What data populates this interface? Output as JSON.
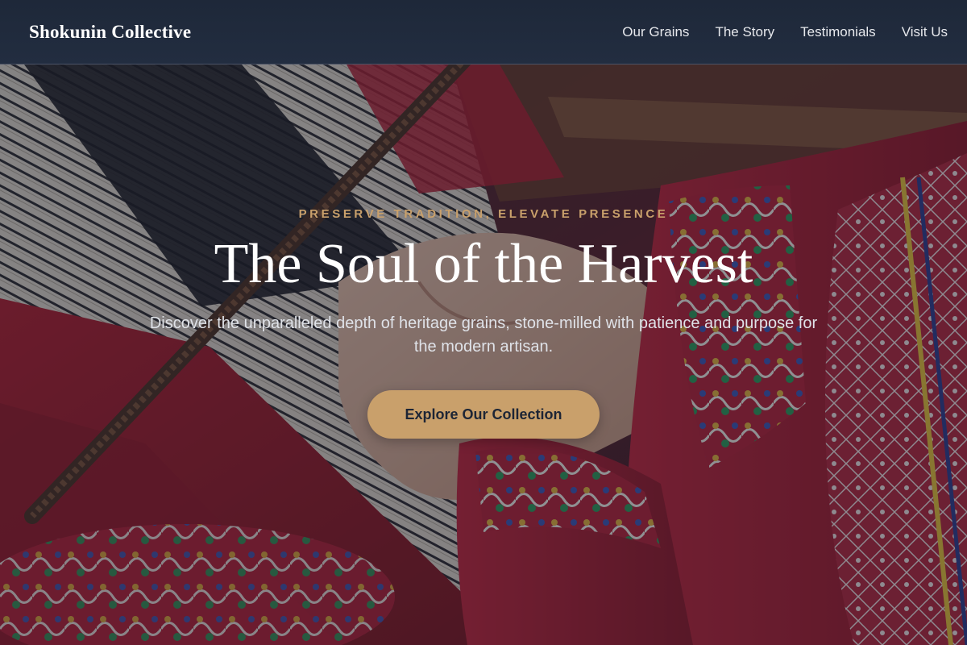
{
  "header": {
    "brand": "Shokunin Collective",
    "nav": [
      {
        "label": "Our Grains"
      },
      {
        "label": "The Story"
      },
      {
        "label": "Testimonials"
      },
      {
        "label": "Visit Us"
      }
    ]
  },
  "hero": {
    "eyebrow": "PRESERVE TRADITION, ELEVATE PRESENCE",
    "title": "The Soul of the Harvest",
    "subtitle": "Discover the unparalleled depth of heritage grains, stone-milled with patience and purpose for the modern artisan.",
    "cta_label": "Explore Our Collection",
    "background_image": "weaving-loom-hands-photo"
  },
  "colors": {
    "header_bg": "#1e2839",
    "accent_gold": "#c9a06b",
    "text_white": "#ffffff",
    "button_text": "#1d2535"
  }
}
